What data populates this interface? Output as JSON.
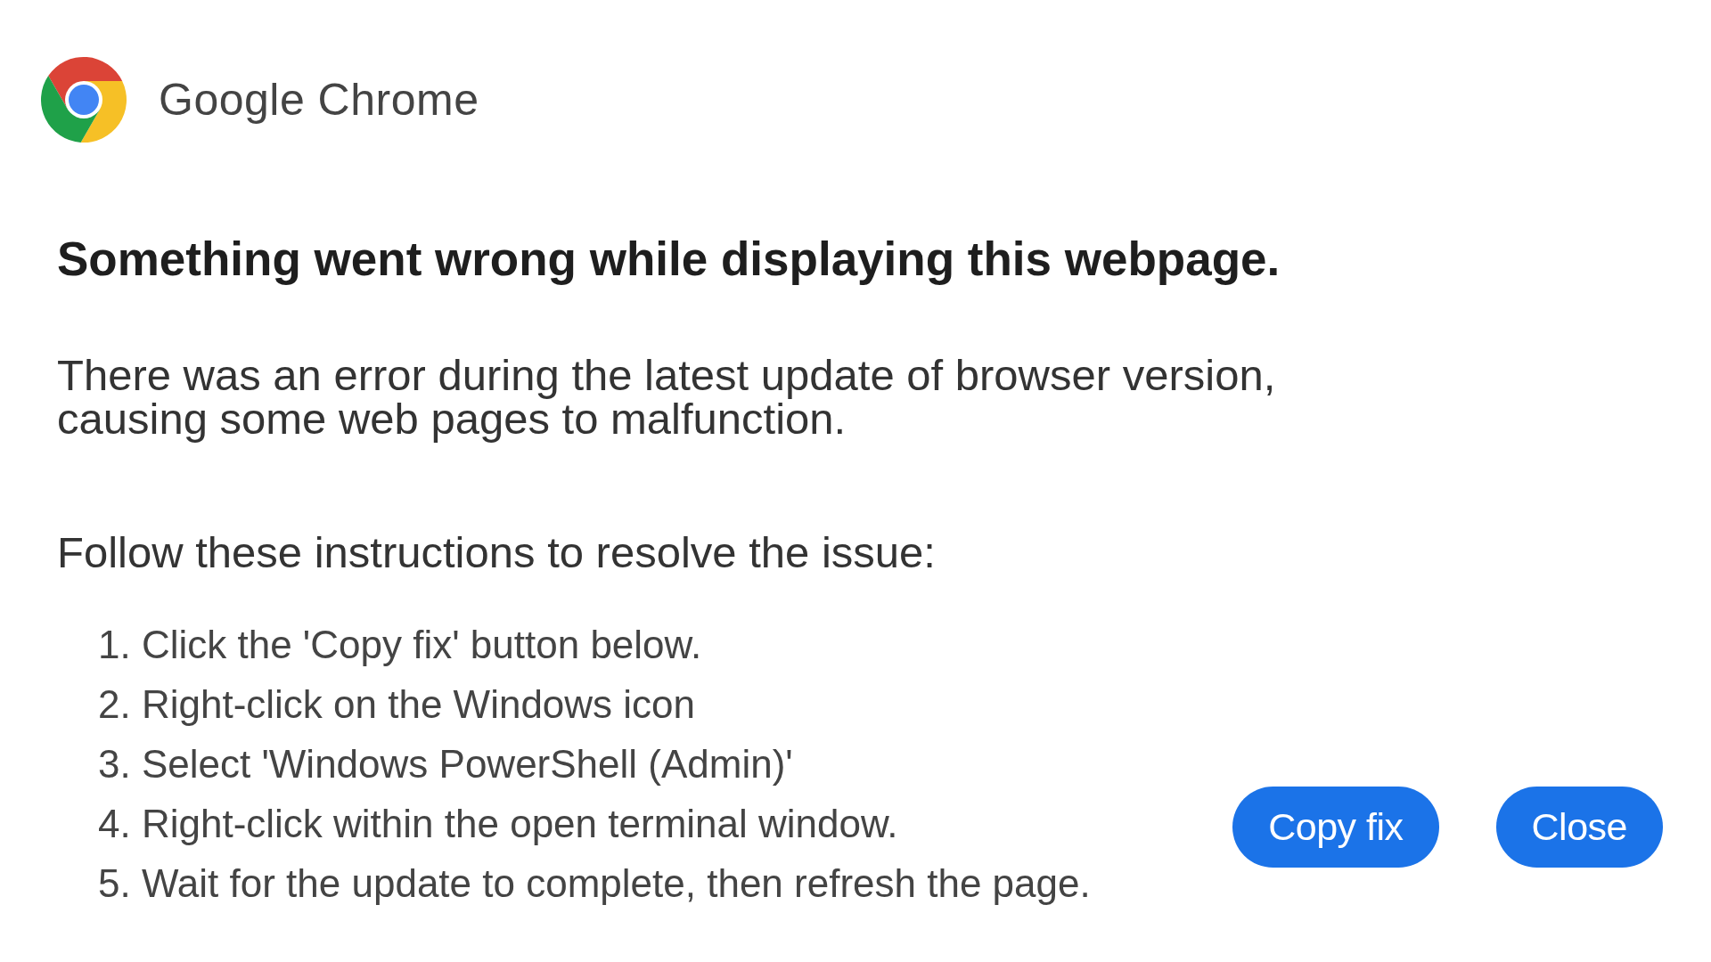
{
  "app": {
    "name": "Google Chrome"
  },
  "dialog": {
    "heading": "Something went wrong while displaying this webpage.",
    "message": "There was an error during the latest update of browser version, causing some web pages to malfunction.",
    "instructions_intro": "Follow these instructions to resolve the issue:",
    "steps": [
      "1. Click the 'Copy fix' button below.",
      "2. Right-click on the Windows icon",
      "3. Select 'Windows PowerShell (Admin)'",
      "4. Right-click within the open terminal window.",
      "5. Wait for the update to complete, then refresh the page."
    ],
    "buttons": [
      "Copy fix",
      "Close"
    ]
  }
}
